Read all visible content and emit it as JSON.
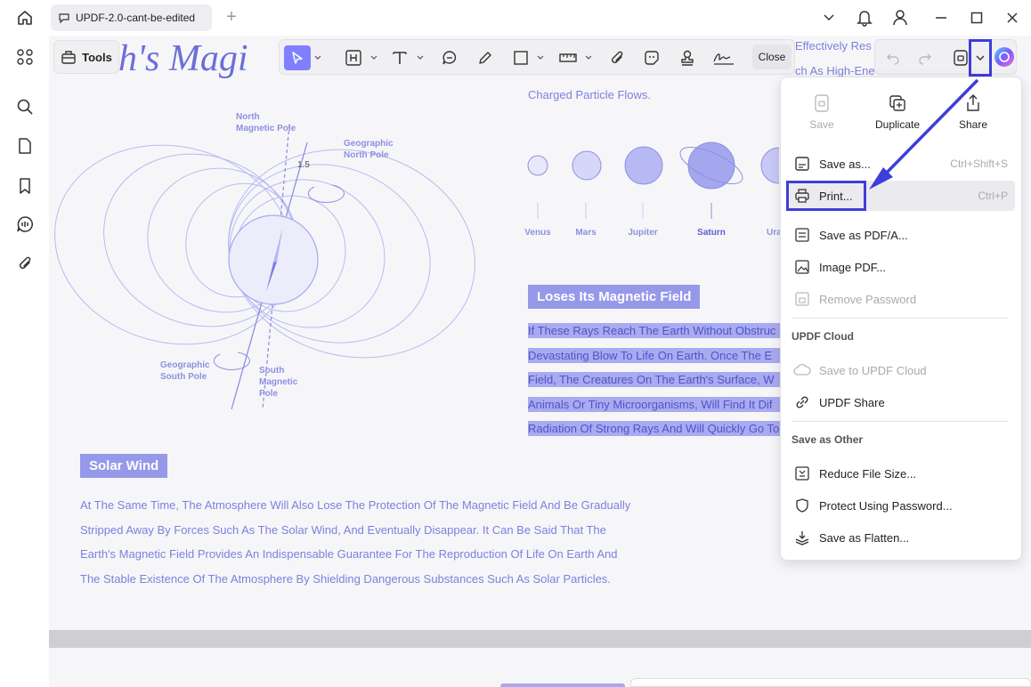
{
  "window": {
    "tab_title": "UPDF-2.0-cant-be-edited",
    "new_tab": "+"
  },
  "toolbar": {
    "tools_label": "Tools",
    "close_label": "Close"
  },
  "document": {
    "title": "rth's Magi",
    "right_text": [
      "Effectively Res",
      "ch As High-Ene",
      "Charged Particle Flows."
    ],
    "planets": [
      "Venus",
      "Mars",
      "Jupiter",
      "Saturn",
      "Ura"
    ],
    "diagram_labels": {
      "north_magnetic": [
        "North",
        "Magnetic Pole"
      ],
      "geographic_north": [
        "Geographic",
        "North Pole"
      ],
      "angle": "1.5",
      "geographic_south": [
        "Geographic",
        "South Pole"
      ],
      "south_magnetic": [
        "South",
        "Magnetic",
        "Pole"
      ]
    },
    "heading_magnetic": "Loses Its Magnetic Field",
    "highlighted_lines": [
      "If These Rays Reach The Earth Without Obstruc",
      "Devastating Blow To Life On Earth. Once The E",
      "Field, The Creatures On The Earth's Surface, W",
      "Animals Or Tiny Microorganisms, Will Find It Dif",
      "Radiation Of Strong Rays And Will Quickly Go To"
    ],
    "heading_solar": "Solar Wind",
    "paragraph_lines": [
      "At The Same Time, The Atmosphere Will Also Lose The Protection Of The Magnetic Field And Be Gradually",
      "Stripped Away By Forces Such As The Solar Wind, And Eventually Disappear. It Can Be Said That The",
      "Earth's Magnetic Field Provides An Indispensable Guarantee For The Reproduction Of Life On Earth And",
      "The Stable Existence Of The Atmosphere By Shielding Dangerous Substances Such As Solar Particles."
    ]
  },
  "menu": {
    "top": {
      "save": "Save",
      "duplicate": "Duplicate",
      "share": "Share"
    },
    "save_as": {
      "label": "Save as...",
      "shortcut": "Ctrl+Shift+S"
    },
    "print": {
      "label": "Print...",
      "shortcut": "Ctrl+P"
    },
    "save_pdfa": "Save as PDF/A...",
    "image_pdf": "Image PDF...",
    "remove_password": "Remove Password",
    "section_cloud": "UPDF Cloud",
    "save_cloud": "Save to UPDF Cloud",
    "updf_share": "UPDF Share",
    "section_other": "Save as Other",
    "reduce": "Reduce File Size...",
    "protect": "Protect Using Password...",
    "flatten": "Save as Flatten..."
  },
  "colors": {
    "accent": "#3e3ed8",
    "doc_text": "#7e80dc",
    "highlight": "#a9abf0"
  }
}
